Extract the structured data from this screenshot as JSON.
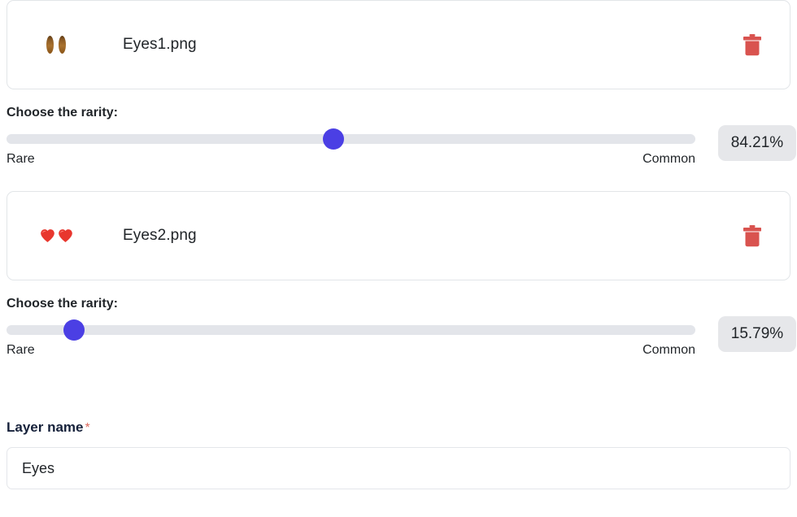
{
  "layers": [
    {
      "thumb_icon": "brown-eyes-image",
      "file_name": "Eyes1.png",
      "delete_icon": "trash-icon",
      "rarity_label": "Choose the rarity:",
      "slider": {
        "min_label": "Rare",
        "max_label": "Common",
        "value_percent": 84.21,
        "value_text": "84.21%",
        "thumb_position_percent": 47.5,
        "track_color": "#e3e5ea",
        "thumb_color": "#4b3fe4"
      }
    },
    {
      "thumb_icon": "red-hearts-image",
      "file_name": "Eyes2.png",
      "delete_icon": "trash-icon",
      "rarity_label": "Choose the rarity:",
      "slider": {
        "min_label": "Rare",
        "max_label": "Common",
        "value_percent": 15.79,
        "value_text": "15.79%",
        "thumb_position_percent": 9.8,
        "track_color": "#e3e5ea",
        "thumb_color": "#4b3fe4"
      }
    }
  ],
  "layer_name": {
    "label": "Layer name",
    "required_marker": "*",
    "value": "Eyes",
    "placeholder": "Layer name"
  },
  "colors": {
    "accent": "#4b3fe4",
    "danger": "#d9534f",
    "required": "#dc6a5e",
    "badge_bg": "#e6e7ea",
    "border": "#e2e5e8"
  }
}
